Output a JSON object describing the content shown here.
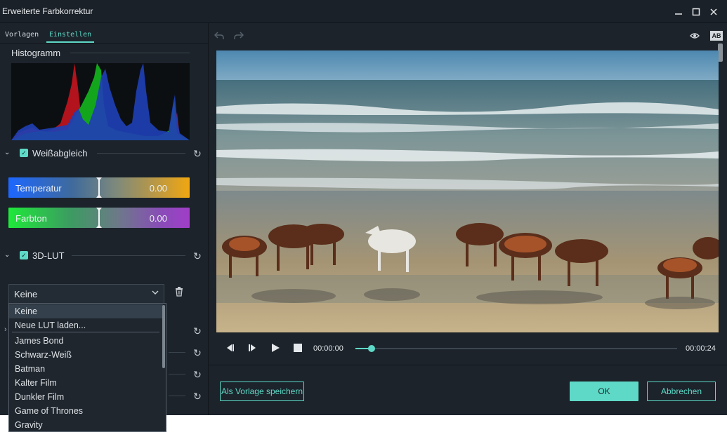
{
  "window": {
    "title": "Erweiterte Farbkorrektur"
  },
  "tabs": [
    {
      "label": "Vorlagen"
    },
    {
      "label": "Einstellen"
    }
  ],
  "histogram": {
    "label": "Histogramm"
  },
  "white_balance": {
    "label": "Weißabgleich",
    "enabled": true,
    "temperature": {
      "label": "Temperatur",
      "value": "0.00"
    },
    "tint": {
      "label": "Farbton",
      "value": "0.00"
    }
  },
  "lut": {
    "label": "3D-LUT",
    "enabled": true,
    "selected": "Keine",
    "options": [
      "Keine",
      "Neue LUT laden...",
      "James Bond",
      "Schwarz-Weiß",
      "Batman",
      "Kalter Film",
      "Dunkler Film",
      "Game of Thrones",
      "Gravity"
    ]
  },
  "player": {
    "current_time": "00:00:00",
    "total_time": "00:00:24",
    "progress": 0.05
  },
  "buttons": {
    "save_preset": "Als Vorlage speichern",
    "ok": "OK",
    "cancel": "Abbrechen"
  },
  "colors": {
    "accent": "#5fd9c7",
    "background": "#1c232b"
  }
}
